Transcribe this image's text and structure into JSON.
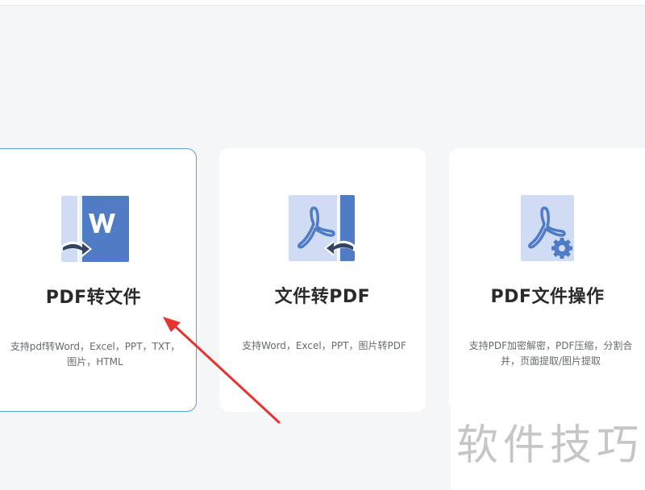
{
  "cards": [
    {
      "id": "pdf-to-file",
      "icon": "word-document-arrow-icon",
      "title": "PDF转文件",
      "desc": "支持pdf转Word，Excel，PPT，TXT，\n图片，HTML",
      "selected": true
    },
    {
      "id": "file-to-pdf",
      "icon": "pdf-document-arrow-icon",
      "title": "文件转PDF",
      "desc": "支持Word，Excel，PPT，图片转PDF",
      "selected": false
    },
    {
      "id": "pdf-ops",
      "icon": "pdf-document-gear-icon",
      "title": "PDF文件操作",
      "desc": "支持PDF加密解密，PDF压缩，分割合\n并，页面提取/图片提取",
      "selected": false
    }
  ],
  "watermark": "软件技巧",
  "colors": {
    "accent_border": "#5aa0d6",
    "icon_dark": "#4f7cc4",
    "icon_light": "#cfdcf4",
    "arrow_annotation": "#e8322f"
  }
}
